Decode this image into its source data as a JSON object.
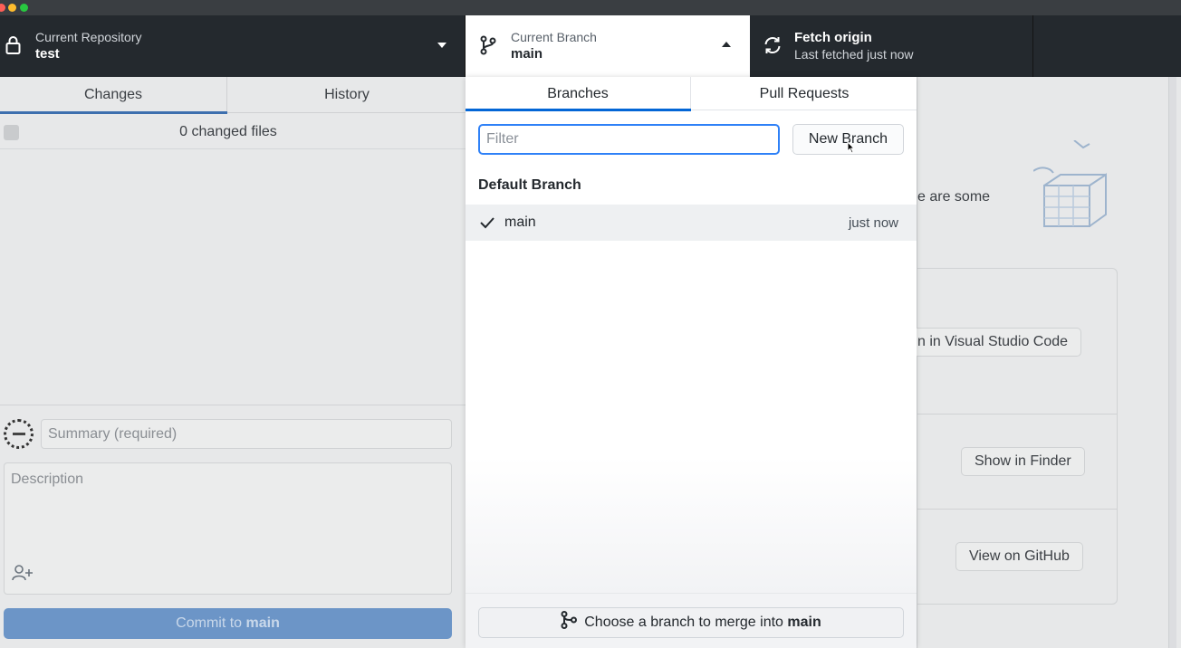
{
  "toolbar": {
    "repo": {
      "title": "Current Repository",
      "value": "test"
    },
    "branch": {
      "title": "Current Branch",
      "value": "main"
    },
    "fetch": {
      "title": "Fetch origin",
      "status": "Last fetched just now"
    }
  },
  "left_pane": {
    "tabs": [
      {
        "label": "Changes",
        "selected": true
      },
      {
        "label": "History",
        "selected": false
      }
    ],
    "changed_files": "0 changed files",
    "summary_placeholder": "Summary (required)",
    "description_placeholder": "Description",
    "commit_button": {
      "prefix": "Commit to ",
      "branch": "main"
    }
  },
  "right_pane": {
    "partial_text": "e are some",
    "buttons": [
      {
        "label": "n in Visual Studio Code"
      },
      {
        "label": "Show in Finder"
      },
      {
        "label": "View on GitHub"
      }
    ]
  },
  "branch_dropdown": {
    "tabs": [
      {
        "label": "Branches",
        "selected": true
      },
      {
        "label": "Pull Requests",
        "selected": false
      }
    ],
    "filter_placeholder": "Filter",
    "new_branch_label": "New Branch",
    "section_header": "Default Branch",
    "branches": [
      {
        "name": "main",
        "time": "just now",
        "checked": true
      }
    ],
    "merge_button": {
      "prefix": "Choose a branch to merge into ",
      "branch": "main"
    }
  },
  "colors": {
    "accent": "#0366d6",
    "toolbar_bg": "#24292e",
    "commit_button_disabled": "#6c95c7"
  }
}
